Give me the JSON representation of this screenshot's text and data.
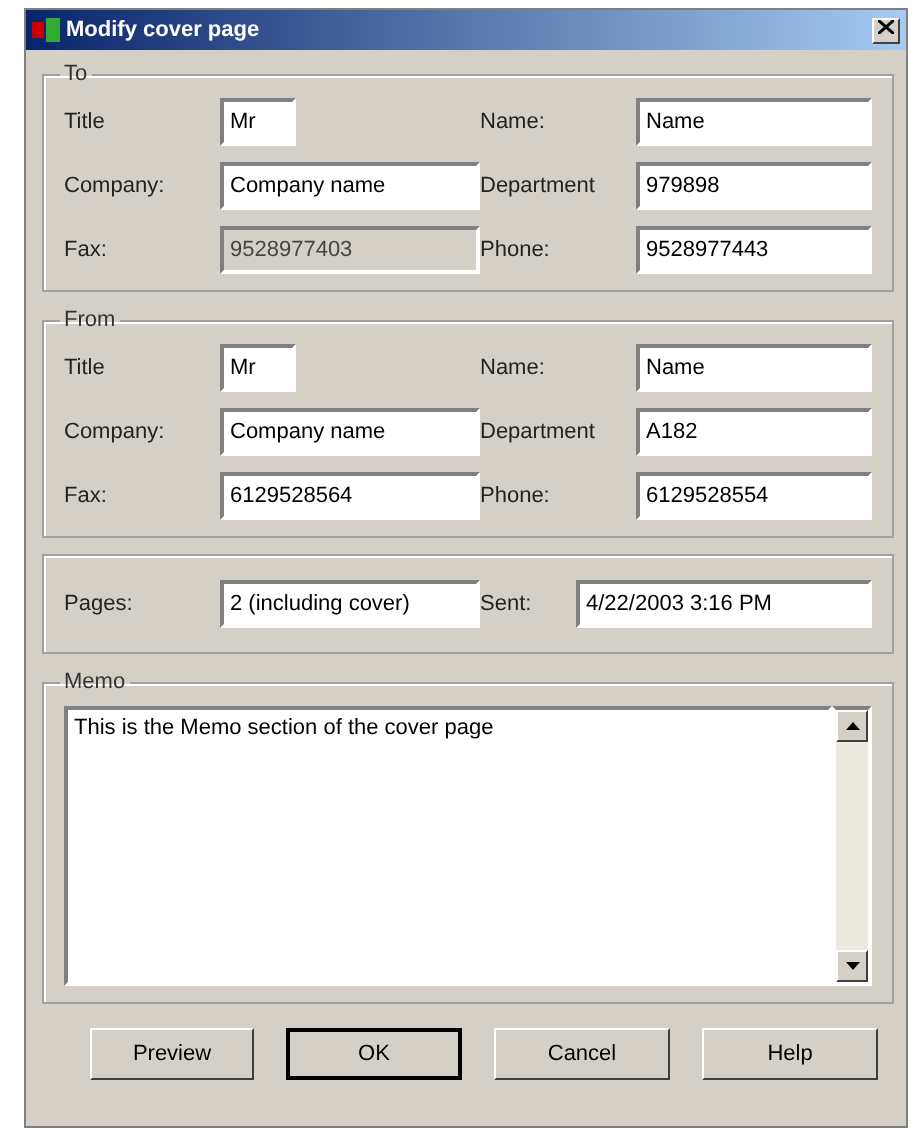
{
  "window": {
    "title": "Modify cover page"
  },
  "groups": [
    {
      "title": "To",
      "rows": [
        [
          {
            "label": "Title",
            "value": "Mr",
            "disabled": false
          },
          {
            "label": "Name:",
            "value": "Name",
            "disabled": false
          }
        ],
        [
          {
            "label": "Company:",
            "value": "Company name",
            "disabled": false
          },
          {
            "label": "Department",
            "value": "979898",
            "disabled": false
          }
        ],
        [
          {
            "label": "Fax:",
            "value": "9528977403",
            "disabled": true
          },
          {
            "label": "Phone:",
            "value": "9528977443",
            "disabled": false
          }
        ]
      ]
    },
    {
      "title": "From",
      "rows": [
        [
          {
            "label": "Title",
            "value": "Mr",
            "disabled": false
          },
          {
            "label": "Name:",
            "value": "Name",
            "disabled": false
          }
        ],
        [
          {
            "label": "Company:",
            "value": "Company name",
            "disabled": false
          },
          {
            "label": "Department",
            "value": "A182",
            "disabled": false
          }
        ],
        [
          {
            "label": "Fax:",
            "value": "6129528564",
            "disabled": false
          },
          {
            "label": "Phone:",
            "value": "6129528554",
            "disabled": false
          }
        ]
      ]
    }
  ],
  "info": [
    {
      "label": "Pages:",
      "value": "2 (including cover)",
      "disabled": false
    },
    {
      "label": "Sent:",
      "value": "4/22/2003 3:16 PM",
      "disabled": false
    }
  ],
  "memo": {
    "title": "Memo",
    "value": "This is the Memo section of the cover page"
  },
  "buttons": [
    {
      "label": "Preview",
      "default": false
    },
    {
      "label": "OK",
      "default": true
    },
    {
      "label": "Cancel",
      "default": false
    },
    {
      "label": "Help",
      "default": false
    }
  ]
}
